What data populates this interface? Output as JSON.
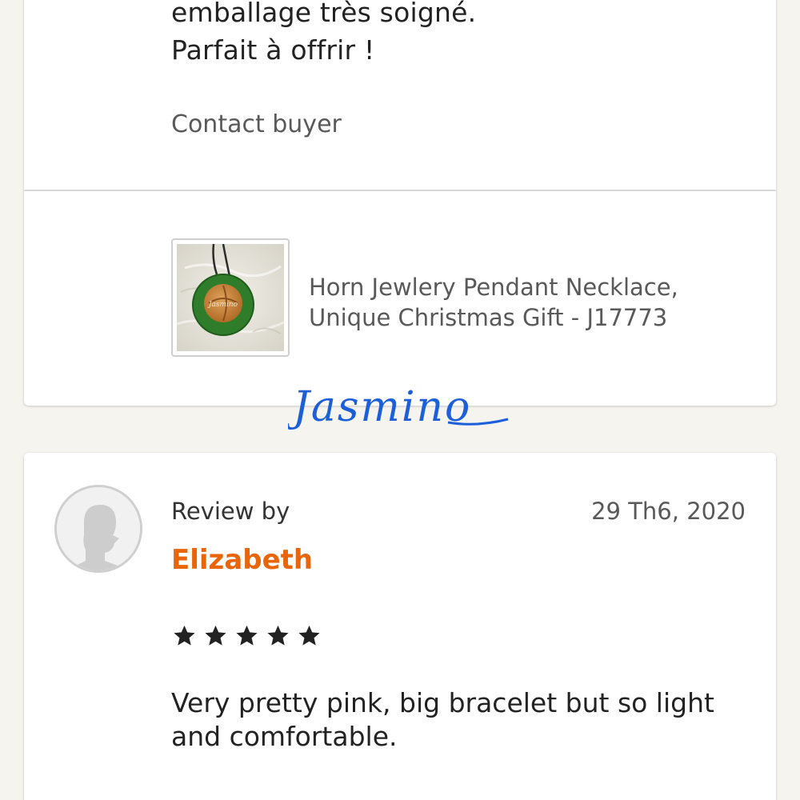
{
  "previous_review": {
    "text_line1": "emballage très soigné.",
    "text_line2": "Parfait à offrir !",
    "contact_label": "Contact buyer"
  },
  "item": {
    "title": "Horn Jewlery Pendant Necklace, Unique Christmas Gift - J17773",
    "image_icon": "green-round-pendant-necklace",
    "pendant_engraving": "Jasmino"
  },
  "watermark": {
    "text": "Jasmino",
    "color": "#1d5fd8"
  },
  "review": {
    "avatar_icon": "default-user-avatar-icon",
    "by_label": "Review by",
    "reviewer": "Elizabeth",
    "date": "29 Th6, 2020",
    "rating": 5,
    "rating_max": 5,
    "text": "Very pretty pink, big bracelet but so light and comfortable."
  },
  "colors": {
    "background": "#f5f4ef",
    "card": "#ffffff",
    "reviewer_name": "#e8650a",
    "muted_text": "#595959",
    "star": "#222222"
  }
}
